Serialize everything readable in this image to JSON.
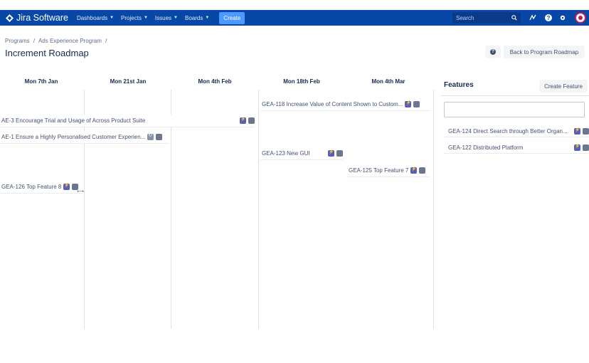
{
  "nav": {
    "brand": "Jira Software",
    "items": [
      {
        "label": "Dashboards"
      },
      {
        "label": "Projects"
      },
      {
        "label": "Issues"
      },
      {
        "label": "Boards"
      }
    ],
    "create_label": "Create",
    "search_placeholder": "Search",
    "accent": "#0747a6"
  },
  "header": {
    "breadcrumb": [
      "Programs",
      "/",
      "Ads Experience Program",
      "/"
    ],
    "title": "Increment Roadmap",
    "help_label": "?",
    "back_label": "Back to Program Roadmap"
  },
  "roadmap": {
    "columns": [
      {
        "label": "Mon 7th Jan"
      },
      {
        "label": "Mon 21st Jan"
      },
      {
        "label": "Mon 4th Feb"
      },
      {
        "label": "Mon 18th Feb"
      },
      {
        "label": "Mon 4th Mar"
      }
    ],
    "cards": [
      {
        "title": "GEA-118 Increase Value of Content Shown to Custom..."
      },
      {
        "title": "AE-3 Encourage Trial and Usage of Across Product Suite"
      },
      {
        "title": "AE-1 Ensure a Highly Personalised Customer Experien..."
      },
      {
        "title": "GEA-123 New GUI"
      },
      {
        "title": "GEA-125 Top Feature 7"
      },
      {
        "title": "GEA-126 Top Feature 8"
      }
    ]
  },
  "features": {
    "title": "Features",
    "create_label": "Create Feature",
    "search_value": "",
    "items": [
      {
        "title": "GEA-124 Direct Search through Better Organ..."
      },
      {
        "title": "GEA-122 Distributed Platform"
      }
    ]
  }
}
